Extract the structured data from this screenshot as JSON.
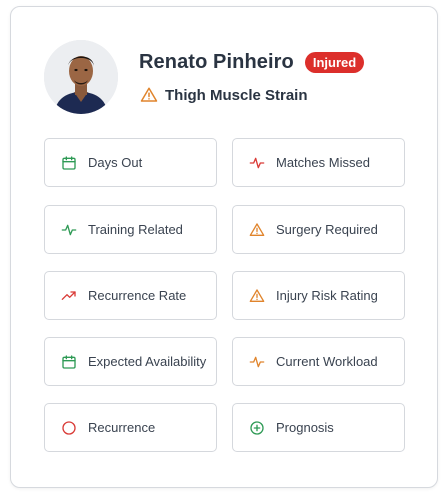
{
  "player": {
    "name": "Renato Pinheiro",
    "status": "Injured",
    "injury": "Thigh Muscle Strain"
  },
  "colors": {
    "injured_badge": "#dc2f2b",
    "warning": "#e0842c",
    "danger": "#d93a36",
    "success": "#2e9a55"
  },
  "tiles": [
    {
      "label": "Days Out",
      "icon": "calendar-icon"
    },
    {
      "label": "Matches Missed",
      "icon": "activity-red-icon"
    },
    {
      "label": "Training Related",
      "icon": "activity-green-icon"
    },
    {
      "label": "Surgery Required",
      "icon": "warning-triangle-icon"
    },
    {
      "label": "Recurrence Rate",
      "icon": "trending-up-icon"
    },
    {
      "label": "Injury Risk Rating",
      "icon": "warning-triangle-icon"
    },
    {
      "label": "Expected Availability",
      "icon": "calendar-icon"
    },
    {
      "label": "Current Workload",
      "icon": "activity-orange-icon"
    },
    {
      "label": "Recurrence",
      "icon": "circle-icon"
    },
    {
      "label": "Prognosis",
      "icon": "plus-circle-icon"
    }
  ]
}
